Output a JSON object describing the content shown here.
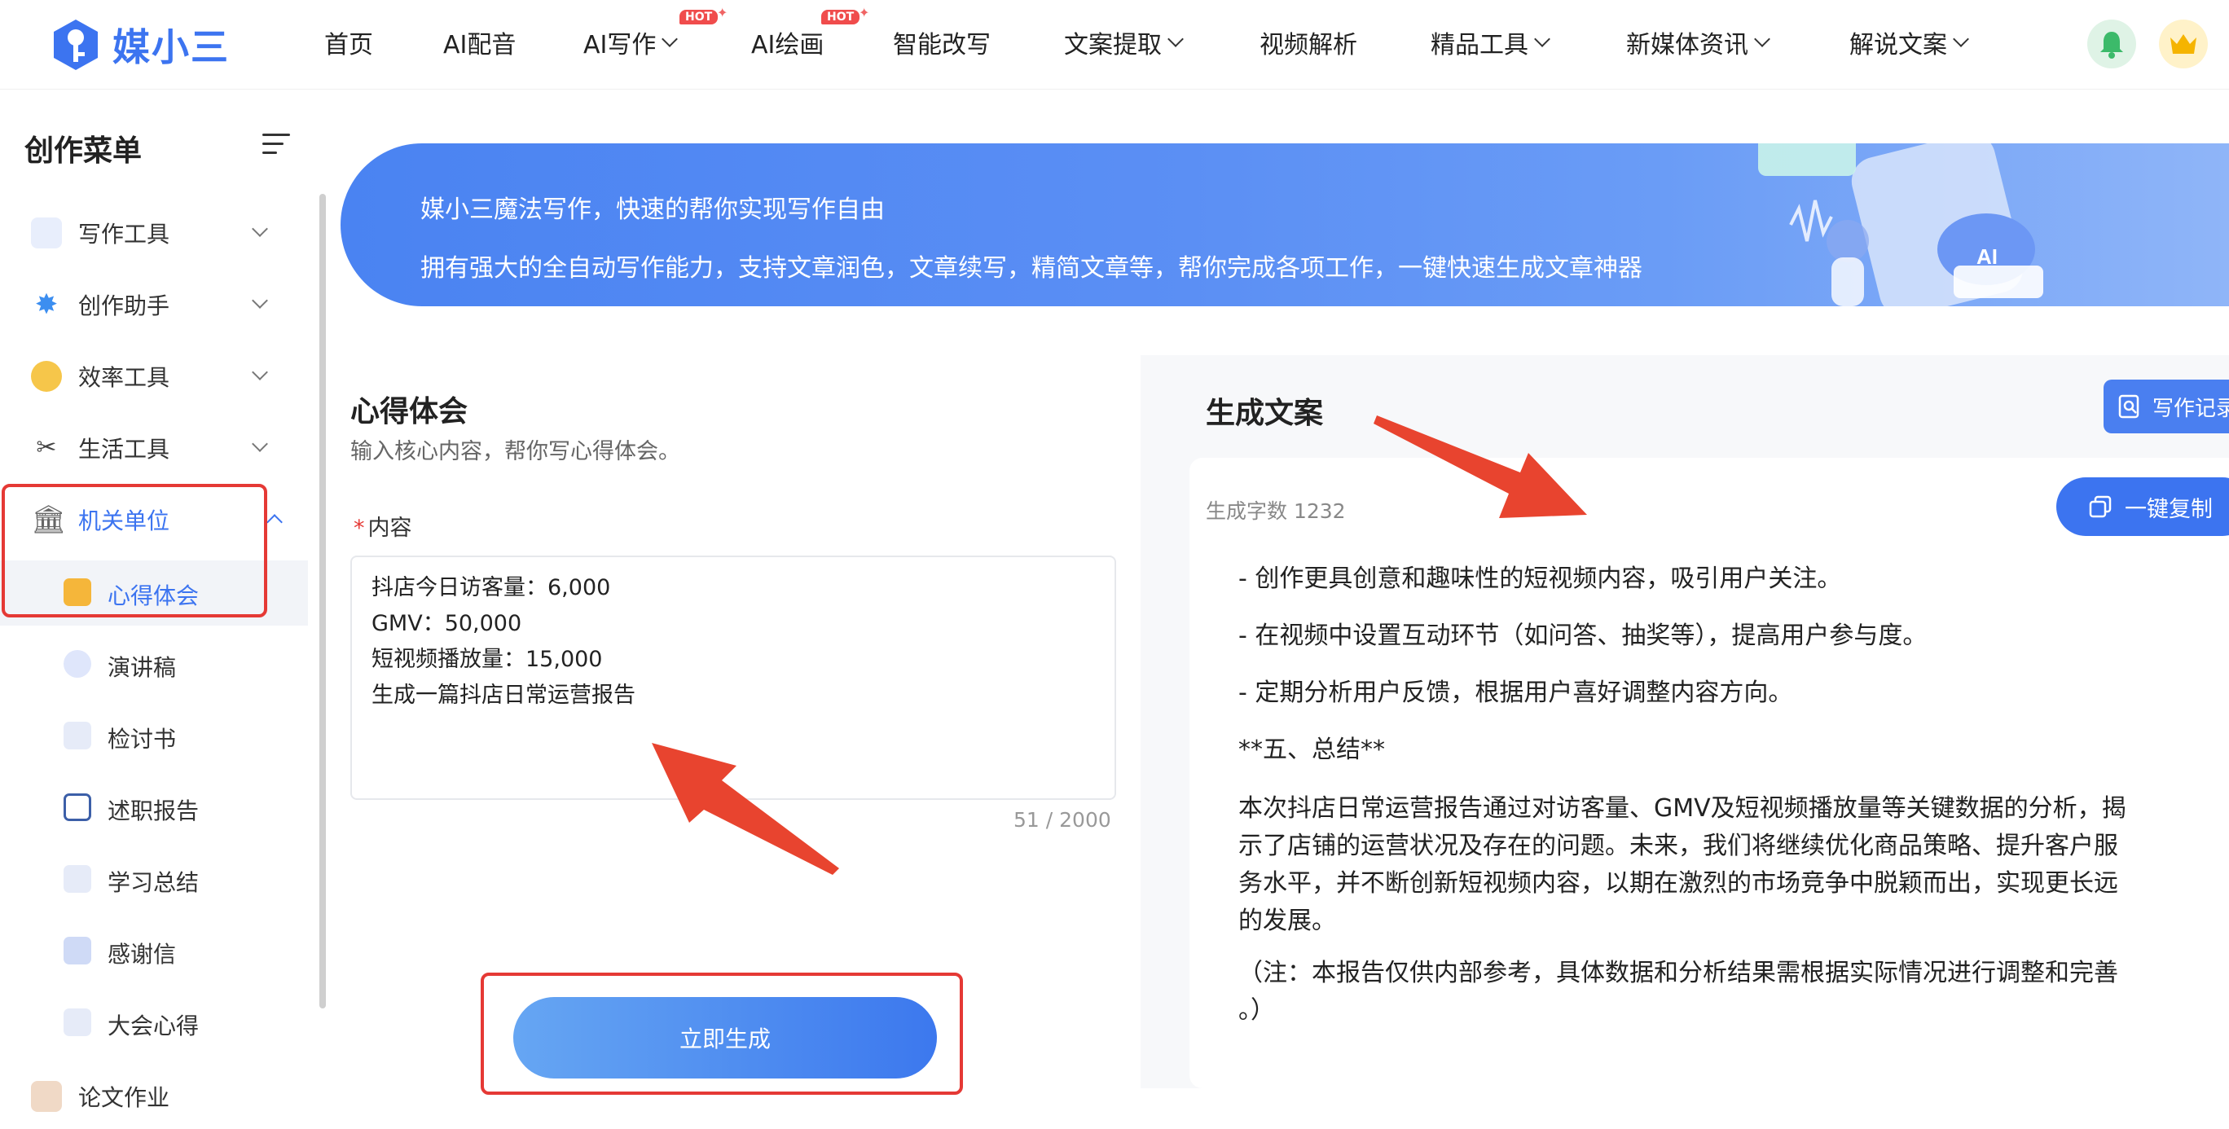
{
  "brand": {
    "name": "媒小三"
  },
  "nav": {
    "items": [
      {
        "label": "首页"
      },
      {
        "label": "AI配音"
      },
      {
        "label": "AI写作",
        "badge": "HOT"
      },
      {
        "label": "AI绘画",
        "badge": "HOT"
      },
      {
        "label": "智能改写"
      },
      {
        "label": "文案提取"
      },
      {
        "label": "视频解析"
      },
      {
        "label": "精品工具"
      },
      {
        "label": "新媒体资讯"
      },
      {
        "label": "解说文案"
      }
    ]
  },
  "sidebar": {
    "title": "创作菜单",
    "groups": [
      {
        "label": "写作工具"
      },
      {
        "label": "创作助手"
      },
      {
        "label": "效率工具"
      },
      {
        "label": "生活工具"
      },
      {
        "label": "机关单位"
      }
    ],
    "sub_items": [
      {
        "label": "心得体会"
      },
      {
        "label": "演讲稿"
      },
      {
        "label": "检讨书"
      },
      {
        "label": "述职报告"
      },
      {
        "label": "学习总结"
      },
      {
        "label": "感谢信"
      },
      {
        "label": "大会心得"
      }
    ],
    "next_group": "论文作业"
  },
  "banner": {
    "line1": "媒小三魔法写作，快速的帮你实现写作自由",
    "line2": "拥有强大的全自动写作能力，支持文章润色，文章续写，精简文章等，帮你完成各项工作，一键快速生成文章神器"
  },
  "form": {
    "title": "心得体会",
    "desc": "输入核心内容，帮你写心得体会。",
    "field_label": "内容",
    "content_lines": [
      "抖店今日访客量：6,000",
      "GMV：50,000",
      "短视频播放量：15,000",
      "生成一篇抖店日常运营报告"
    ],
    "char_count": "51 / 2000",
    "submit_label": "立即生成"
  },
  "result": {
    "title": "生成文案",
    "record_label": "写作记录",
    "word_count": "生成字数 1232",
    "copy_label": "一键复制",
    "lines": [
      "- 创作更具创意和趣味性的短视频内容，吸引用户关注。",
      "- 在视频中设置互动环节（如问答、抽奖等），提高用户参与度。",
      "- 定期分析用户反馈，根据用户喜好调整内容方向。",
      "**五、总结**"
    ],
    "summary_lines": [
      "本次抖店日常运营报告通过对访客量、GMV及短视频播放量等关键数据的分析，揭",
      "示了店铺的运营状况及存在的问题。未来，我们将继续优化商品策略、提升客户服",
      "务水平，并不断创新短视频内容，以期在激烈的市场竞争中脱颖而出，实现更长远",
      "的发展。"
    ],
    "note_lines": [
      "（注：本报告仅供内部参考，具体数据和分析结果需根据实际情况进行调整和完善",
      "。）"
    ]
  },
  "colors": {
    "primary": "#3c74f0",
    "annotation_red": "#e53935"
  }
}
